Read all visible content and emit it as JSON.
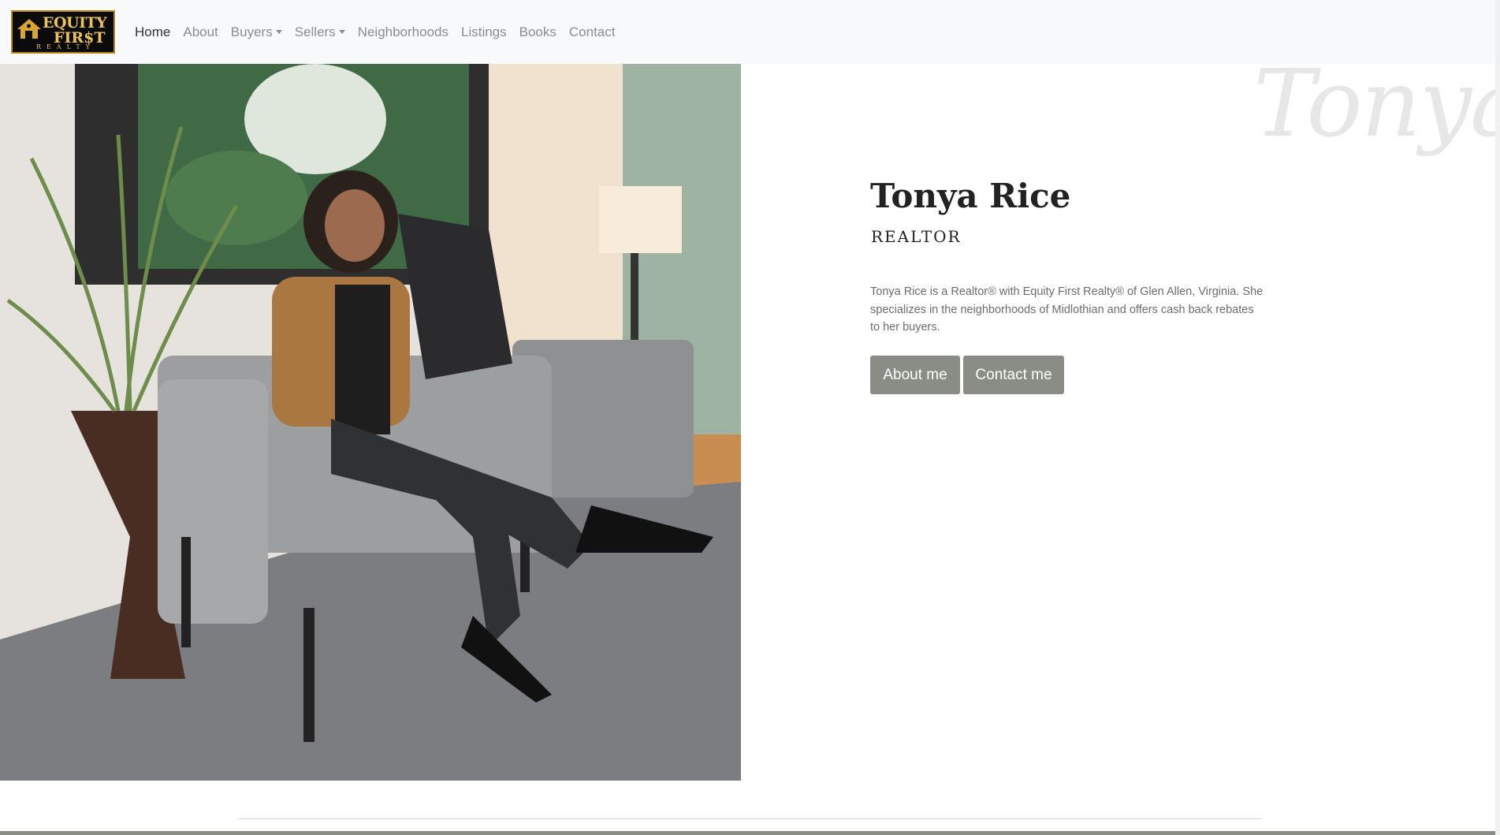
{
  "logo": {
    "line1": "EQUITY",
    "line2": "FIR$T",
    "line3": "REALTY"
  },
  "nav": {
    "items": [
      {
        "label": "Home",
        "active": true,
        "dropdown": false
      },
      {
        "label": "About",
        "active": false,
        "dropdown": false
      },
      {
        "label": "Buyers",
        "active": false,
        "dropdown": true
      },
      {
        "label": "Sellers",
        "active": false,
        "dropdown": true
      },
      {
        "label": "Neighborhoods",
        "active": false,
        "dropdown": false
      },
      {
        "label": "Listings",
        "active": false,
        "dropdown": false
      },
      {
        "label": "Books",
        "active": false,
        "dropdown": false
      },
      {
        "label": "Contact",
        "active": false,
        "dropdown": false
      }
    ]
  },
  "hero": {
    "signature": "Tonya",
    "name": "Tonya Rice",
    "title": "REALTOR",
    "bio": "Tonya Rice is a Realtor® with Equity First Realty® of Glen Allen, Virginia. She specializes in the neighborhoods of Midlothian and offers cash back rebates to her buyers.",
    "buttons": {
      "about": "About me",
      "contact": "Contact me"
    }
  },
  "colors": {
    "navbar_bg": "#f8f9fa",
    "button_bg": "#8a8c86",
    "logo_gold": "#e9c25a"
  }
}
